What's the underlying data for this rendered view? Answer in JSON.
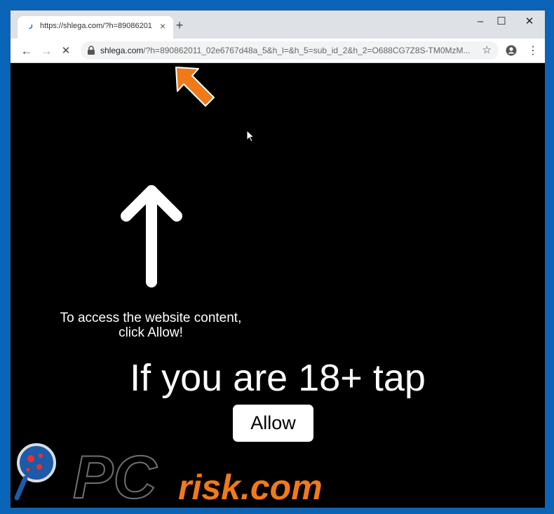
{
  "browser": {
    "tab": {
      "title": "https://shlega.com/?h=89086201",
      "close_glyph": "×"
    },
    "new_tab_glyph": "+",
    "window": {
      "minimize_glyph": "–",
      "maximize_glyph": "☐",
      "close_glyph": "✕"
    },
    "nav": {
      "back_glyph": "←",
      "forward_glyph": "→",
      "reload_glyph": "✕"
    },
    "address": {
      "domain": "shlega.com",
      "path": "/?h=890862011_02e6767d48a_5&h_l=&h_5=sub_id_2&h_2=O688CG7Z8S-TM0MzM..."
    },
    "star_glyph": "☆",
    "menu_glyph": "⋮"
  },
  "page": {
    "hint_line1": "To access the website content,",
    "hint_line2": "click Allow!",
    "headline": "If you are 18+ tap",
    "allow_label": "Allow"
  },
  "watermark": {
    "text_pc": "PC",
    "text_rest": "risk.com"
  },
  "colors": {
    "accent_orange": "#f07a1a",
    "frame_blue": "#0a64b8",
    "page_bg": "#000000"
  },
  "icons": [
    "lock-icon",
    "star-icon",
    "account-icon",
    "menu-icon",
    "orange-pointer-arrow-icon",
    "mouse-cursor-icon",
    "white-up-arrow-icon"
  ]
}
